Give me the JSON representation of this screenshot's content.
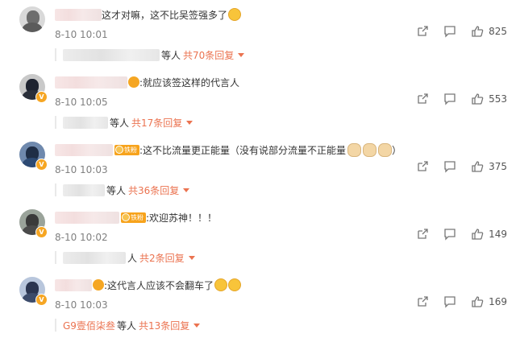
{
  "colors": {
    "accent": "#eb7350",
    "time": "#808080",
    "text": "#333333"
  },
  "comments": [
    {
      "text": "这才对嘛，这不比吴签强多了",
      "time": "8-10 10:01",
      "likes": "825",
      "reply_who": "等人",
      "reply_more": "共70条回复",
      "avatar_bg": "#6d6d6d"
    },
    {
      "text": ":就应该签这样的代言人",
      "time": "8-10 10:05",
      "likes": "553",
      "reply_who": "等人",
      "reply_more": "共17条回复",
      "avatar_bg": "#2a2f3a"
    },
    {
      "badge": "铁粉",
      "text": ":这不比流量更正能量（没有说部分流量不正能量",
      "text_tail": "）",
      "time": "8-10 10:03",
      "likes": "375",
      "reply_who": "等人",
      "reply_more": "共36条回复",
      "avatar_bg": "#2d4a73"
    },
    {
      "badge": "铁粉",
      "text": ":欢迎苏神！！！",
      "time": "8-10 10:02",
      "likes": "149",
      "reply_who": "人",
      "reply_more": "共2条回复",
      "avatar_bg": "#4a4a4a"
    },
    {
      "text": ":这代言人应该不会翻车了",
      "time": "8-10 10:03",
      "likes": "169",
      "reply_name": "G9壹佰柒叁",
      "reply_who": "等人",
      "reply_more": "共13条回复",
      "avatar_bg": "#3c4b6a"
    }
  ],
  "icons": [
    "share-icon",
    "comment-icon",
    "like-icon"
  ]
}
